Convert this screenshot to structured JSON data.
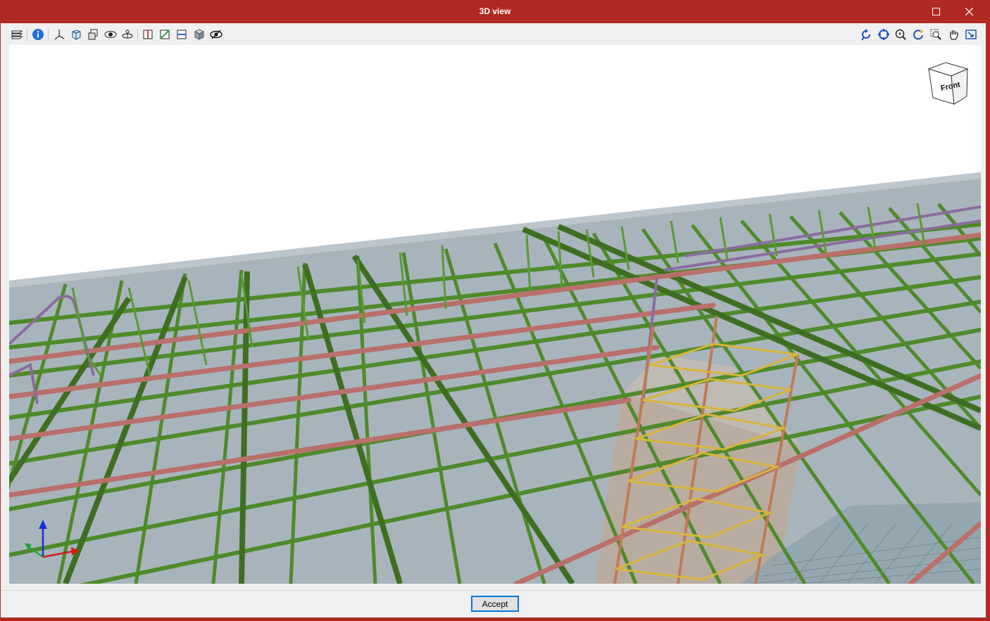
{
  "window": {
    "title": "3D view"
  },
  "toolbar": {
    "left_tools": [
      {
        "name": "layers-icon"
      },
      {
        "name": "info-icon"
      },
      {
        "name": "axes-icon"
      },
      {
        "name": "box-view-icon"
      },
      {
        "name": "multi-box-icon"
      },
      {
        "name": "eye-cube-icon"
      },
      {
        "name": "orbit-icon"
      },
      {
        "name": "section-red-icon"
      },
      {
        "name": "section-green-icon"
      },
      {
        "name": "section-blue-icon"
      },
      {
        "name": "shaded-cube-icon"
      },
      {
        "name": "visibility-eye-icon"
      }
    ],
    "right_tools": [
      {
        "name": "rotate-view-icon"
      },
      {
        "name": "zoom-all-icon"
      },
      {
        "name": "zoom-in-icon"
      },
      {
        "name": "refresh-view-icon"
      },
      {
        "name": "zoom-window-icon"
      },
      {
        "name": "pan-hand-icon"
      },
      {
        "name": "fit-window-icon"
      }
    ]
  },
  "view_cube": {
    "label": "Front"
  },
  "colors": {
    "title_bar": "#b02a22",
    "rebar_green": "#4f8a2b",
    "rebar_red": "#b9706a",
    "rebar_purple": "#8a6c9e",
    "rebar_yellow": "#d7b63a",
    "slab": "#a8b4bc",
    "column": "#b8aca0"
  },
  "footer": {
    "accept_label": "Accept"
  }
}
